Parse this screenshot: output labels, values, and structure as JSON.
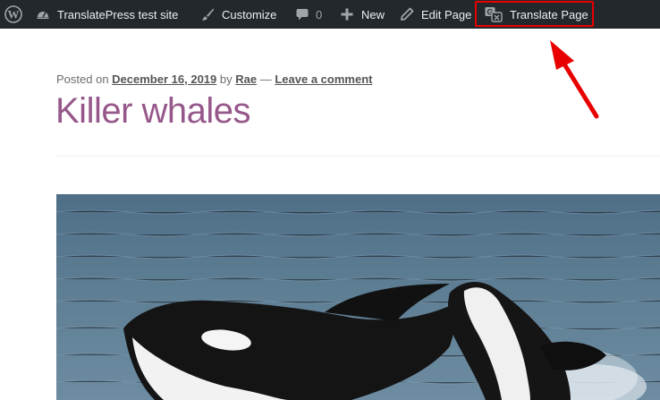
{
  "adminbar": {
    "site_name": "TranslatePress test site",
    "customize_label": "Customize",
    "comments_count": "0",
    "new_label": "New",
    "edit_label": "Edit Page",
    "translate_label": "Translate Page",
    "icons": [
      "wordpress-logo-icon",
      "dashboard-icon",
      "paintbrush-icon",
      "comment-bubble-icon",
      "plus-icon",
      "pencil-icon",
      "translate-icon"
    ]
  },
  "post": {
    "posted_on_prefix": "Posted on",
    "date": "December 16, 2019",
    "by": "by",
    "author": "Rae",
    "separator": "—",
    "comment_link": "Leave a comment",
    "title": "Killer whales"
  },
  "colors": {
    "adminbar_bg": "#23282d",
    "title": "#96588a",
    "annotation_red": "#e80000"
  }
}
